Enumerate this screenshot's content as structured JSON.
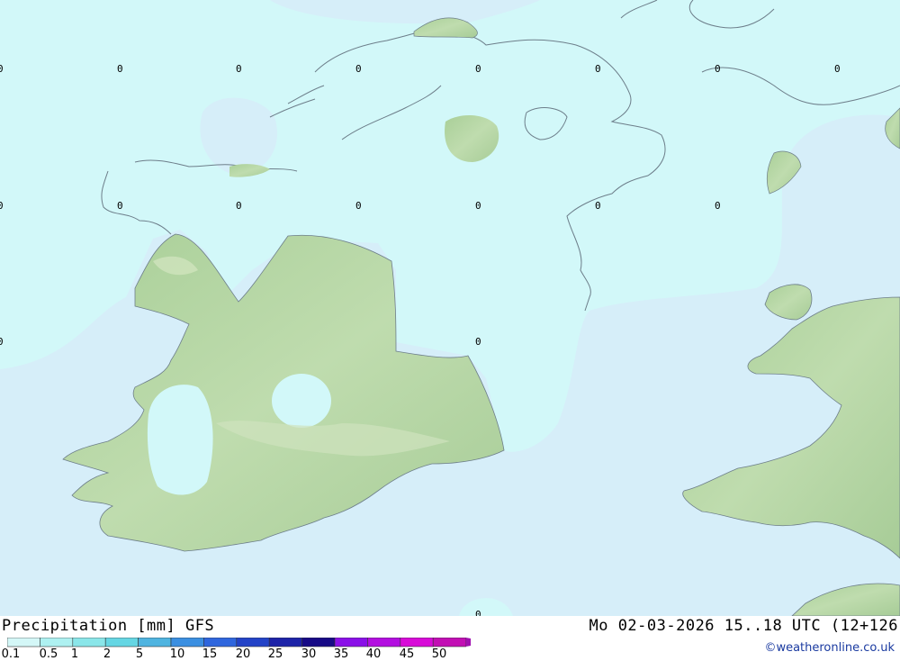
{
  "legend": {
    "title": "Precipitation [mm] GFS",
    "valid_time": "Mo 02-03-2026 15..18 UTC (12+126",
    "credit": "©weatheronline.co.uk",
    "ticks": [
      "0.1",
      "0.5",
      "1",
      "2",
      "5",
      "10",
      "15",
      "20",
      "25",
      "30",
      "35",
      "40",
      "45",
      "50"
    ],
    "colors": [
      "#d4f7f7",
      "#aef1f1",
      "#8ae6e9",
      "#65d6e3",
      "#4fb4e0",
      "#3b8fe1",
      "#2f66dd",
      "#2343c7",
      "#1d23a8",
      "#170a86",
      "#8a10e8",
      "#b30ee0",
      "#d80bd8",
      "#c20fb4"
    ],
    "arrow_color": "#a010b0"
  },
  "map": {
    "sea_color": "#d6eef9",
    "zero_precip_color": "#d2f8f9",
    "land_color": "#b4d6a6",
    "grid_label": "0"
  }
}
